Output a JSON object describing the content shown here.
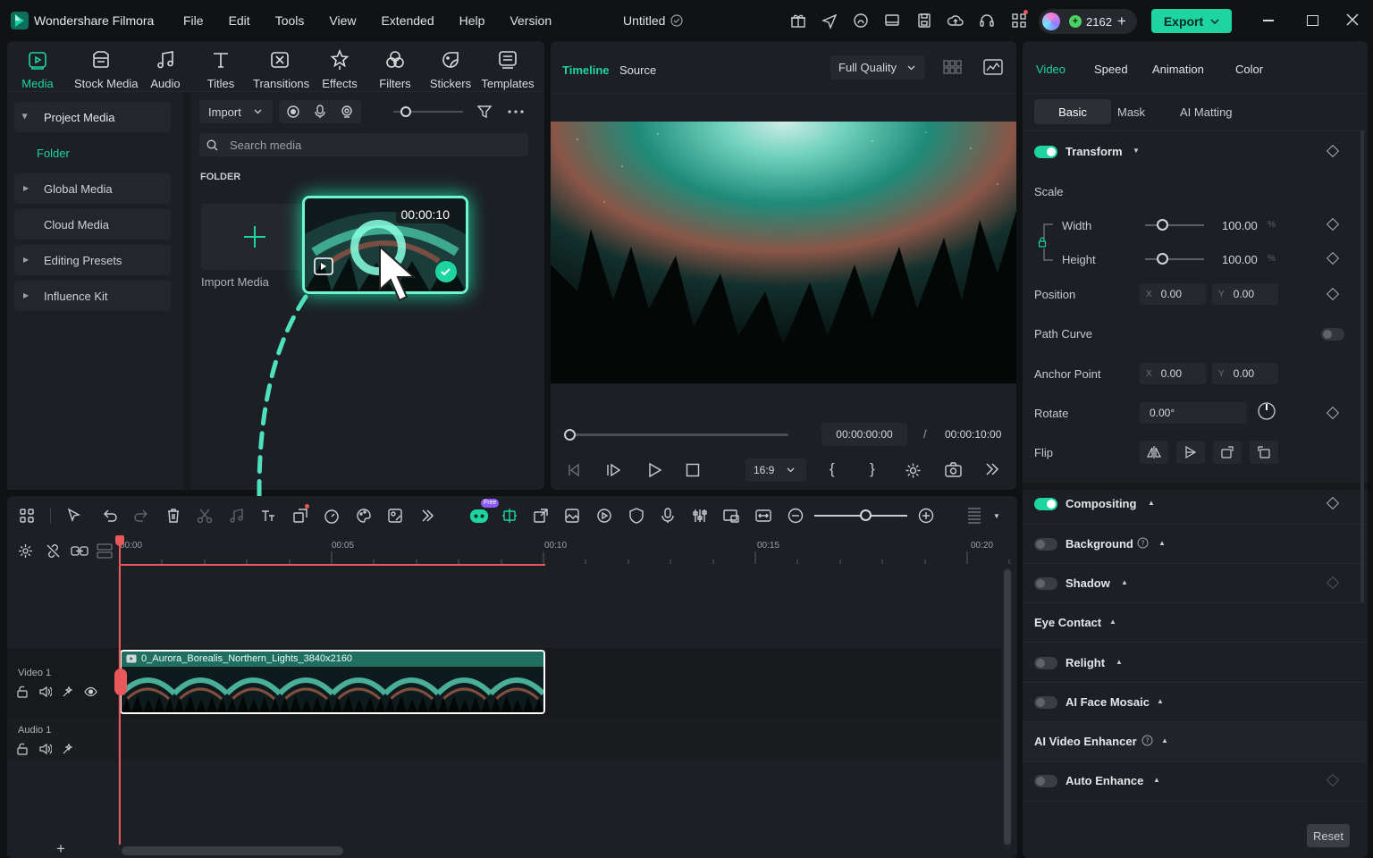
{
  "app": {
    "name": "Wondershare Filmora",
    "doc_title": "Untitled"
  },
  "menu": [
    "File",
    "Edit",
    "Tools",
    "View",
    "Extended",
    "Help",
    "Version"
  ],
  "credits": "2162",
  "export_label": "Export",
  "media_tabs": [
    {
      "label": "Media",
      "icon": "media-icon"
    },
    {
      "label": "Stock Media",
      "icon": "stock-media-icon"
    },
    {
      "label": "Audio",
      "icon": "audio-icon"
    },
    {
      "label": "Titles",
      "icon": "titles-icon"
    },
    {
      "label": "Transitions",
      "icon": "transitions-icon"
    },
    {
      "label": "Effects",
      "icon": "effects-icon"
    },
    {
      "label": "Filters",
      "icon": "filters-icon"
    },
    {
      "label": "Stickers",
      "icon": "stickers-icon"
    },
    {
      "label": "Templates",
      "icon": "templates-icon"
    }
  ],
  "sidebar": {
    "project_media": "Project Media",
    "folder": "Folder",
    "global_media": "Global Media",
    "cloud_media": "Cloud Media",
    "editing_presets": "Editing Presets",
    "influence_kit": "Influence Kit"
  },
  "media": {
    "import_label": "Import",
    "search_placeholder": "Search media",
    "folder_heading": "FOLDER",
    "import_media": "Import Media",
    "clip_duration": "00:00:10"
  },
  "preview": {
    "tab_timeline": "Timeline",
    "tab_source": "Source",
    "quality": "Full Quality",
    "current_time": "00:00:00:00",
    "separator": "/",
    "total_time": "00:00:10:00",
    "aspect": "16:9",
    "bracket_in": "{",
    "bracket_out": "}"
  },
  "properties": {
    "tabs": [
      "Video",
      "Speed",
      "Animation",
      "Color"
    ],
    "subtabs": [
      "Basic",
      "Mask",
      "AI Matting"
    ],
    "transform": "Transform",
    "scale": "Scale",
    "width": "Width",
    "width_value": "100.00",
    "height": "Height",
    "height_value": "100.00",
    "percent": "%",
    "position": "Position",
    "x_label": "X",
    "y_label": "Y",
    "pos_x": "0.00",
    "pos_y": "0.00",
    "path_curve": "Path Curve",
    "anchor_point": "Anchor Point",
    "anchor_x": "0.00",
    "anchor_y": "0.00",
    "rotate": "Rotate",
    "rotate_value": "0.00°",
    "flip": "Flip",
    "compositing": "Compositing",
    "background": "Background",
    "shadow": "Shadow",
    "eye_contact": "Eye Contact",
    "relight": "Relight",
    "ai_face_mosaic": "AI Face Mosaic",
    "ai_video_enhancer": "AI Video Enhancer",
    "auto_enhance": "Auto Enhance",
    "reset": "Reset"
  },
  "timeline": {
    "ruler": [
      "00:00",
      "00:05",
      "00:10",
      "00:15",
      "00:20"
    ],
    "video_track": "Video 1",
    "audio_track": "Audio 1",
    "clip_name": "0_Aurora_Borealis_Northern_Lights_3840x2160",
    "free_badge": "Free",
    "add": "+"
  },
  "colors": {
    "accent": "#1ed4a0",
    "playhead": "#e8585a",
    "panel": "#1c1f23"
  }
}
